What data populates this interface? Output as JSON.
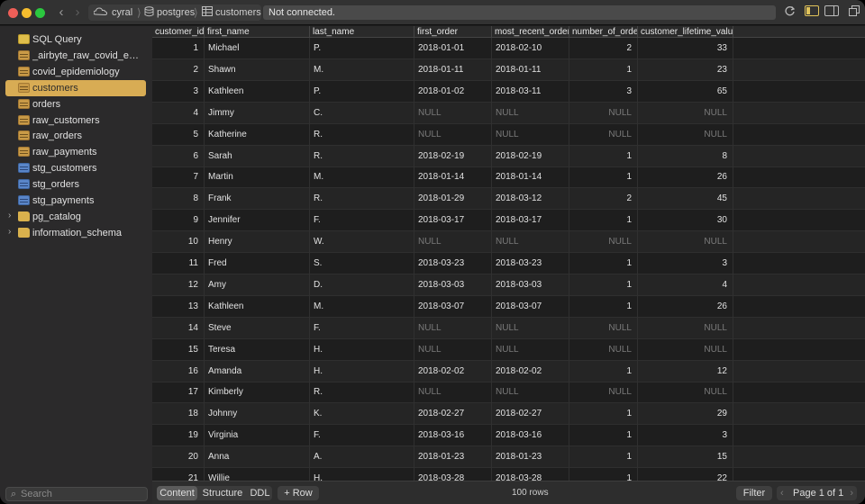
{
  "toolbar": {
    "breadcrumb": [
      "cyral",
      "postgres",
      "customers"
    ],
    "status": "Not connected."
  },
  "sidebar": {
    "items": [
      {
        "label": "SQL Query",
        "icon": "query",
        "selected": false,
        "expandable": false
      },
      {
        "label": "_airbyte_raw_covid_epidemi...",
        "icon": "table",
        "selected": false,
        "expandable": false
      },
      {
        "label": "covid_epidemiology",
        "icon": "table",
        "selected": false,
        "expandable": false
      },
      {
        "label": "customers",
        "icon": "table",
        "selected": true,
        "expandable": false
      },
      {
        "label": "orders",
        "icon": "table",
        "selected": false,
        "expandable": false
      },
      {
        "label": "raw_customers",
        "icon": "table",
        "selected": false,
        "expandable": false
      },
      {
        "label": "raw_orders",
        "icon": "table",
        "selected": false,
        "expandable": false
      },
      {
        "label": "raw_payments",
        "icon": "table",
        "selected": false,
        "expandable": false
      },
      {
        "label": "stg_customers",
        "icon": "view",
        "selected": false,
        "expandable": false
      },
      {
        "label": "stg_orders",
        "icon": "view",
        "selected": false,
        "expandable": false
      },
      {
        "label": "stg_payments",
        "icon": "view",
        "selected": false,
        "expandable": false
      },
      {
        "label": "pg_catalog",
        "icon": "folder",
        "selected": false,
        "expandable": true
      },
      {
        "label": "information_schema",
        "icon": "folder",
        "selected": false,
        "expandable": true
      }
    ],
    "search_placeholder": "Search"
  },
  "table": {
    "columns": [
      "customer_id",
      "first_name",
      "last_name",
      "first_order",
      "most_recent_order",
      "number_of_orders",
      "customer_lifetime_value"
    ],
    "rows": [
      [
        "1",
        "Michael",
        "P.",
        "2018-01-01",
        "2018-02-10",
        "2",
        "33"
      ],
      [
        "2",
        "Shawn",
        "M.",
        "2018-01-11",
        "2018-01-11",
        "1",
        "23"
      ],
      [
        "3",
        "Kathleen",
        "P.",
        "2018-01-02",
        "2018-03-11",
        "3",
        "65"
      ],
      [
        "4",
        "Jimmy",
        "C.",
        "NULL",
        "NULL",
        "NULL",
        "NULL"
      ],
      [
        "5",
        "Katherine",
        "R.",
        "NULL",
        "NULL",
        "NULL",
        "NULL"
      ],
      [
        "6",
        "Sarah",
        "R.",
        "2018-02-19",
        "2018-02-19",
        "1",
        "8"
      ],
      [
        "7",
        "Martin",
        "M.",
        "2018-01-14",
        "2018-01-14",
        "1",
        "26"
      ],
      [
        "8",
        "Frank",
        "R.",
        "2018-01-29",
        "2018-03-12",
        "2",
        "45"
      ],
      [
        "9",
        "Jennifer",
        "F.",
        "2018-03-17",
        "2018-03-17",
        "1",
        "30"
      ],
      [
        "10",
        "Henry",
        "W.",
        "NULL",
        "NULL",
        "NULL",
        "NULL"
      ],
      [
        "11",
        "Fred",
        "S.",
        "2018-03-23",
        "2018-03-23",
        "1",
        "3"
      ],
      [
        "12",
        "Amy",
        "D.",
        "2018-03-03",
        "2018-03-03",
        "1",
        "4"
      ],
      [
        "13",
        "Kathleen",
        "M.",
        "2018-03-07",
        "2018-03-07",
        "1",
        "26"
      ],
      [
        "14",
        "Steve",
        "F.",
        "NULL",
        "NULL",
        "NULL",
        "NULL"
      ],
      [
        "15",
        "Teresa",
        "H.",
        "NULL",
        "NULL",
        "NULL",
        "NULL"
      ],
      [
        "16",
        "Amanda",
        "H.",
        "2018-02-02",
        "2018-02-02",
        "1",
        "12"
      ],
      [
        "17",
        "Kimberly",
        "R.",
        "NULL",
        "NULL",
        "NULL",
        "NULL"
      ],
      [
        "18",
        "Johnny",
        "K.",
        "2018-02-27",
        "2018-02-27",
        "1",
        "29"
      ],
      [
        "19",
        "Virginia",
        "F.",
        "2018-03-16",
        "2018-03-16",
        "1",
        "3"
      ],
      [
        "20",
        "Anna",
        "A.",
        "2018-01-23",
        "2018-01-23",
        "1",
        "15"
      ],
      [
        "21",
        "Willie",
        "H.",
        "2018-03-28",
        "2018-03-28",
        "1",
        "22"
      ]
    ]
  },
  "bottom": {
    "tabs": [
      "Content",
      "Structure",
      "DDL"
    ],
    "active_tab": "Content",
    "add_row": "+ Row",
    "row_count": "100 rows",
    "filter": "Filter",
    "page": "Page 1 of 1"
  },
  "colors": {
    "selected": "#d8ac54",
    "background": "#1e1e1e",
    "sidebar": "#2b2a2b"
  }
}
